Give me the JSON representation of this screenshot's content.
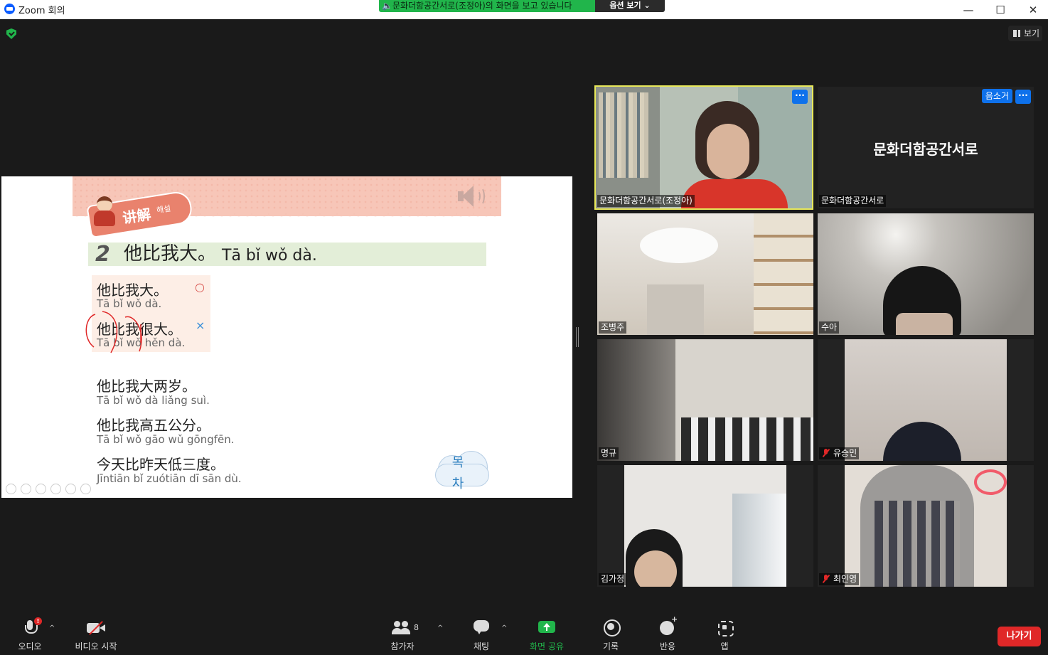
{
  "window": {
    "title": "Zoom 회의",
    "minimize": "—",
    "maximize": "☐",
    "close": "✕"
  },
  "share_banner": {
    "text": "🔈문화더함공간서로(조정아)의 화면을 보고 있습니다",
    "options_label": "옵션 보기 ⌄"
  },
  "top_right": {
    "view_label": "보기"
  },
  "slide": {
    "tag_label": "讲解",
    "tag_sub": "해설",
    "sentence_number": "2",
    "sentence_hanzi": "他比我大。",
    "sentence_pinyin": "Tā bǐ wǒ dà.",
    "examples": [
      {
        "hanzi": "他比我大。",
        "pinyin": "Tā bǐ wǒ dà.",
        "mark": "○"
      },
      {
        "hanzi": "他比我很大。",
        "pinyin": "Tā bǐ wǒ hěn dà.",
        "mark": "×"
      }
    ],
    "more_examples": [
      {
        "hanzi": "他比我大两岁。",
        "pinyin": "Tā bǐ wǒ dà liǎng suì."
      },
      {
        "hanzi": "他比我高五公分。",
        "pinyin": "Tā bǐ wǒ gāo wǔ gōngfēn."
      },
      {
        "hanzi": "今天比昨天低三度。",
        "pinyin": "Jīntiān bǐ zuótiān dī sān dù."
      }
    ],
    "cloud_label": "목차"
  },
  "participants": [
    {
      "name": "문화더함공간서로(조정아)",
      "muted": false,
      "active": true
    },
    {
      "name": "문화더함공간서로",
      "muted": false,
      "big_name": "문화더함공간서로",
      "audio_label": "음소거"
    },
    {
      "name": "조병주",
      "muted": false
    },
    {
      "name": "수아",
      "muted": false
    },
    {
      "name": "명규",
      "muted": false
    },
    {
      "name": "유승민",
      "muted": true
    },
    {
      "name": "김가정",
      "muted": false
    },
    {
      "name": "최인영",
      "muted": true
    }
  ],
  "more_label": "···",
  "toolbar": {
    "audio": "오디오",
    "audio_badge": "!",
    "video": "비디오 시작",
    "participants": "참가자",
    "participants_count": "8",
    "chat": "채팅",
    "share": "화면 공유",
    "record": "기록",
    "reactions": "반응",
    "apps": "앱",
    "leave": "나가기",
    "caret": "^"
  },
  "colors": {
    "share_green": "#21b54b",
    "active_speaker": "#e8e85a",
    "leave_red": "#e02828",
    "zoom_blue": "#0e71eb"
  }
}
